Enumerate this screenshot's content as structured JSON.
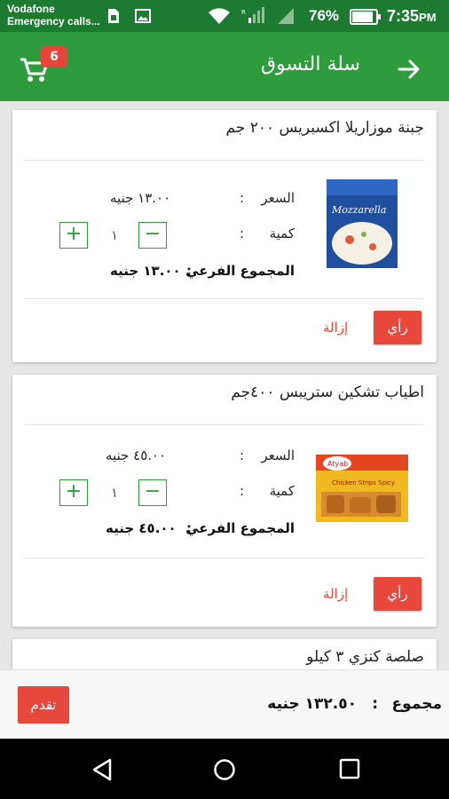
{
  "status_bar": {
    "carrier": "Vodafone",
    "carrier_sub": "Emergency calls...",
    "battery_percent": "76%",
    "time": "7:35",
    "time_suffix": "PM",
    "icons": [
      "sim-icon",
      "image-icon",
      "wifi-icon",
      "signal-icon",
      "battery-icon"
    ]
  },
  "app_bar": {
    "title": "سلة التسوق",
    "cart_count": "6",
    "icons": [
      "cart-icon",
      "arrow-right-icon"
    ],
    "color": "#2e9c3c"
  },
  "cart_items": [
    {
      "title": "جبنة موزاريلا اكسبريس ٢٠٠ جم",
      "price_label": "السعر",
      "price_value": "١٣.٠٠ جنيه",
      "quantity_label": "كمية",
      "quantity_value": "١",
      "subtotal_label": "المجموع الفرعي",
      "subtotal_value": "١٣.٠٠ جنيه",
      "review_label": "رأي",
      "remove_label": "إزالة",
      "image": "mozzarella-package"
    },
    {
      "title": "اطياب تشكين ستريبس ٤٠٠جم",
      "price_label": "السعر",
      "price_value": "٤٥.٠٠ جنيه",
      "quantity_label": "كمية",
      "quantity_value": "١",
      "subtotal_label": "المجموع الفرعي",
      "subtotal_value": "٤٥.٠٠ جنيه",
      "review_label": "رأي",
      "remove_label": "إزالة",
      "image": "chicken-strips-box"
    },
    {
      "title": "صلصة كنزي ٣ كيلو"
    }
  ],
  "footer": {
    "total_label": "مجموع",
    "total_value": "١٣٢.٥٠ جنيه",
    "checkout_label": "تقدم"
  },
  "nav_bar": {
    "icons": [
      "back-icon",
      "home-icon",
      "recents-icon"
    ]
  }
}
